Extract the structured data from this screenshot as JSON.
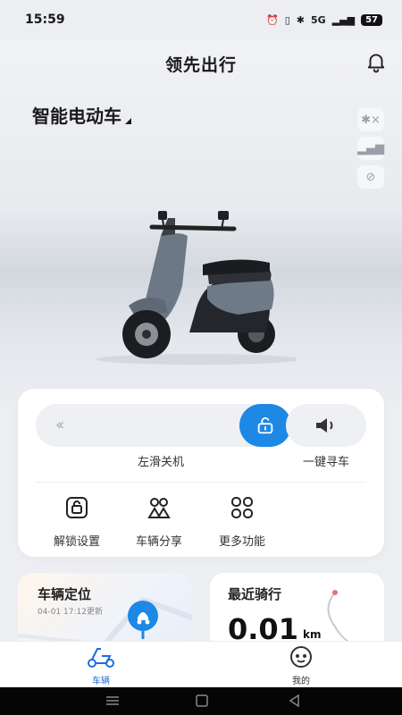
{
  "status_bar": {
    "time": "15:59",
    "network": "5G",
    "battery": "57"
  },
  "header": {
    "title": "领先出行"
  },
  "vehicle": {
    "name": "智能电动车"
  },
  "controls": {
    "slider_arrows": "‹‹",
    "slide_label": "左滑关机",
    "find_label": "一键寻车",
    "features": [
      {
        "label": "解锁设置",
        "icon": "unlock-settings-icon"
      },
      {
        "label": "车辆分享",
        "icon": "share-icon"
      },
      {
        "label": "更多功能",
        "icon": "more-icon"
      }
    ]
  },
  "location_card": {
    "title": "车辆定位",
    "updated": "04-01 17:12更新"
  },
  "ride_card": {
    "title": "最近骑行",
    "value": "0.01",
    "unit": "km"
  },
  "tabs": [
    {
      "label": "车辆"
    },
    {
      "label": "我的"
    }
  ],
  "colors": {
    "accent": "#1e88e5",
    "active_tab": "#1e6fd9"
  }
}
